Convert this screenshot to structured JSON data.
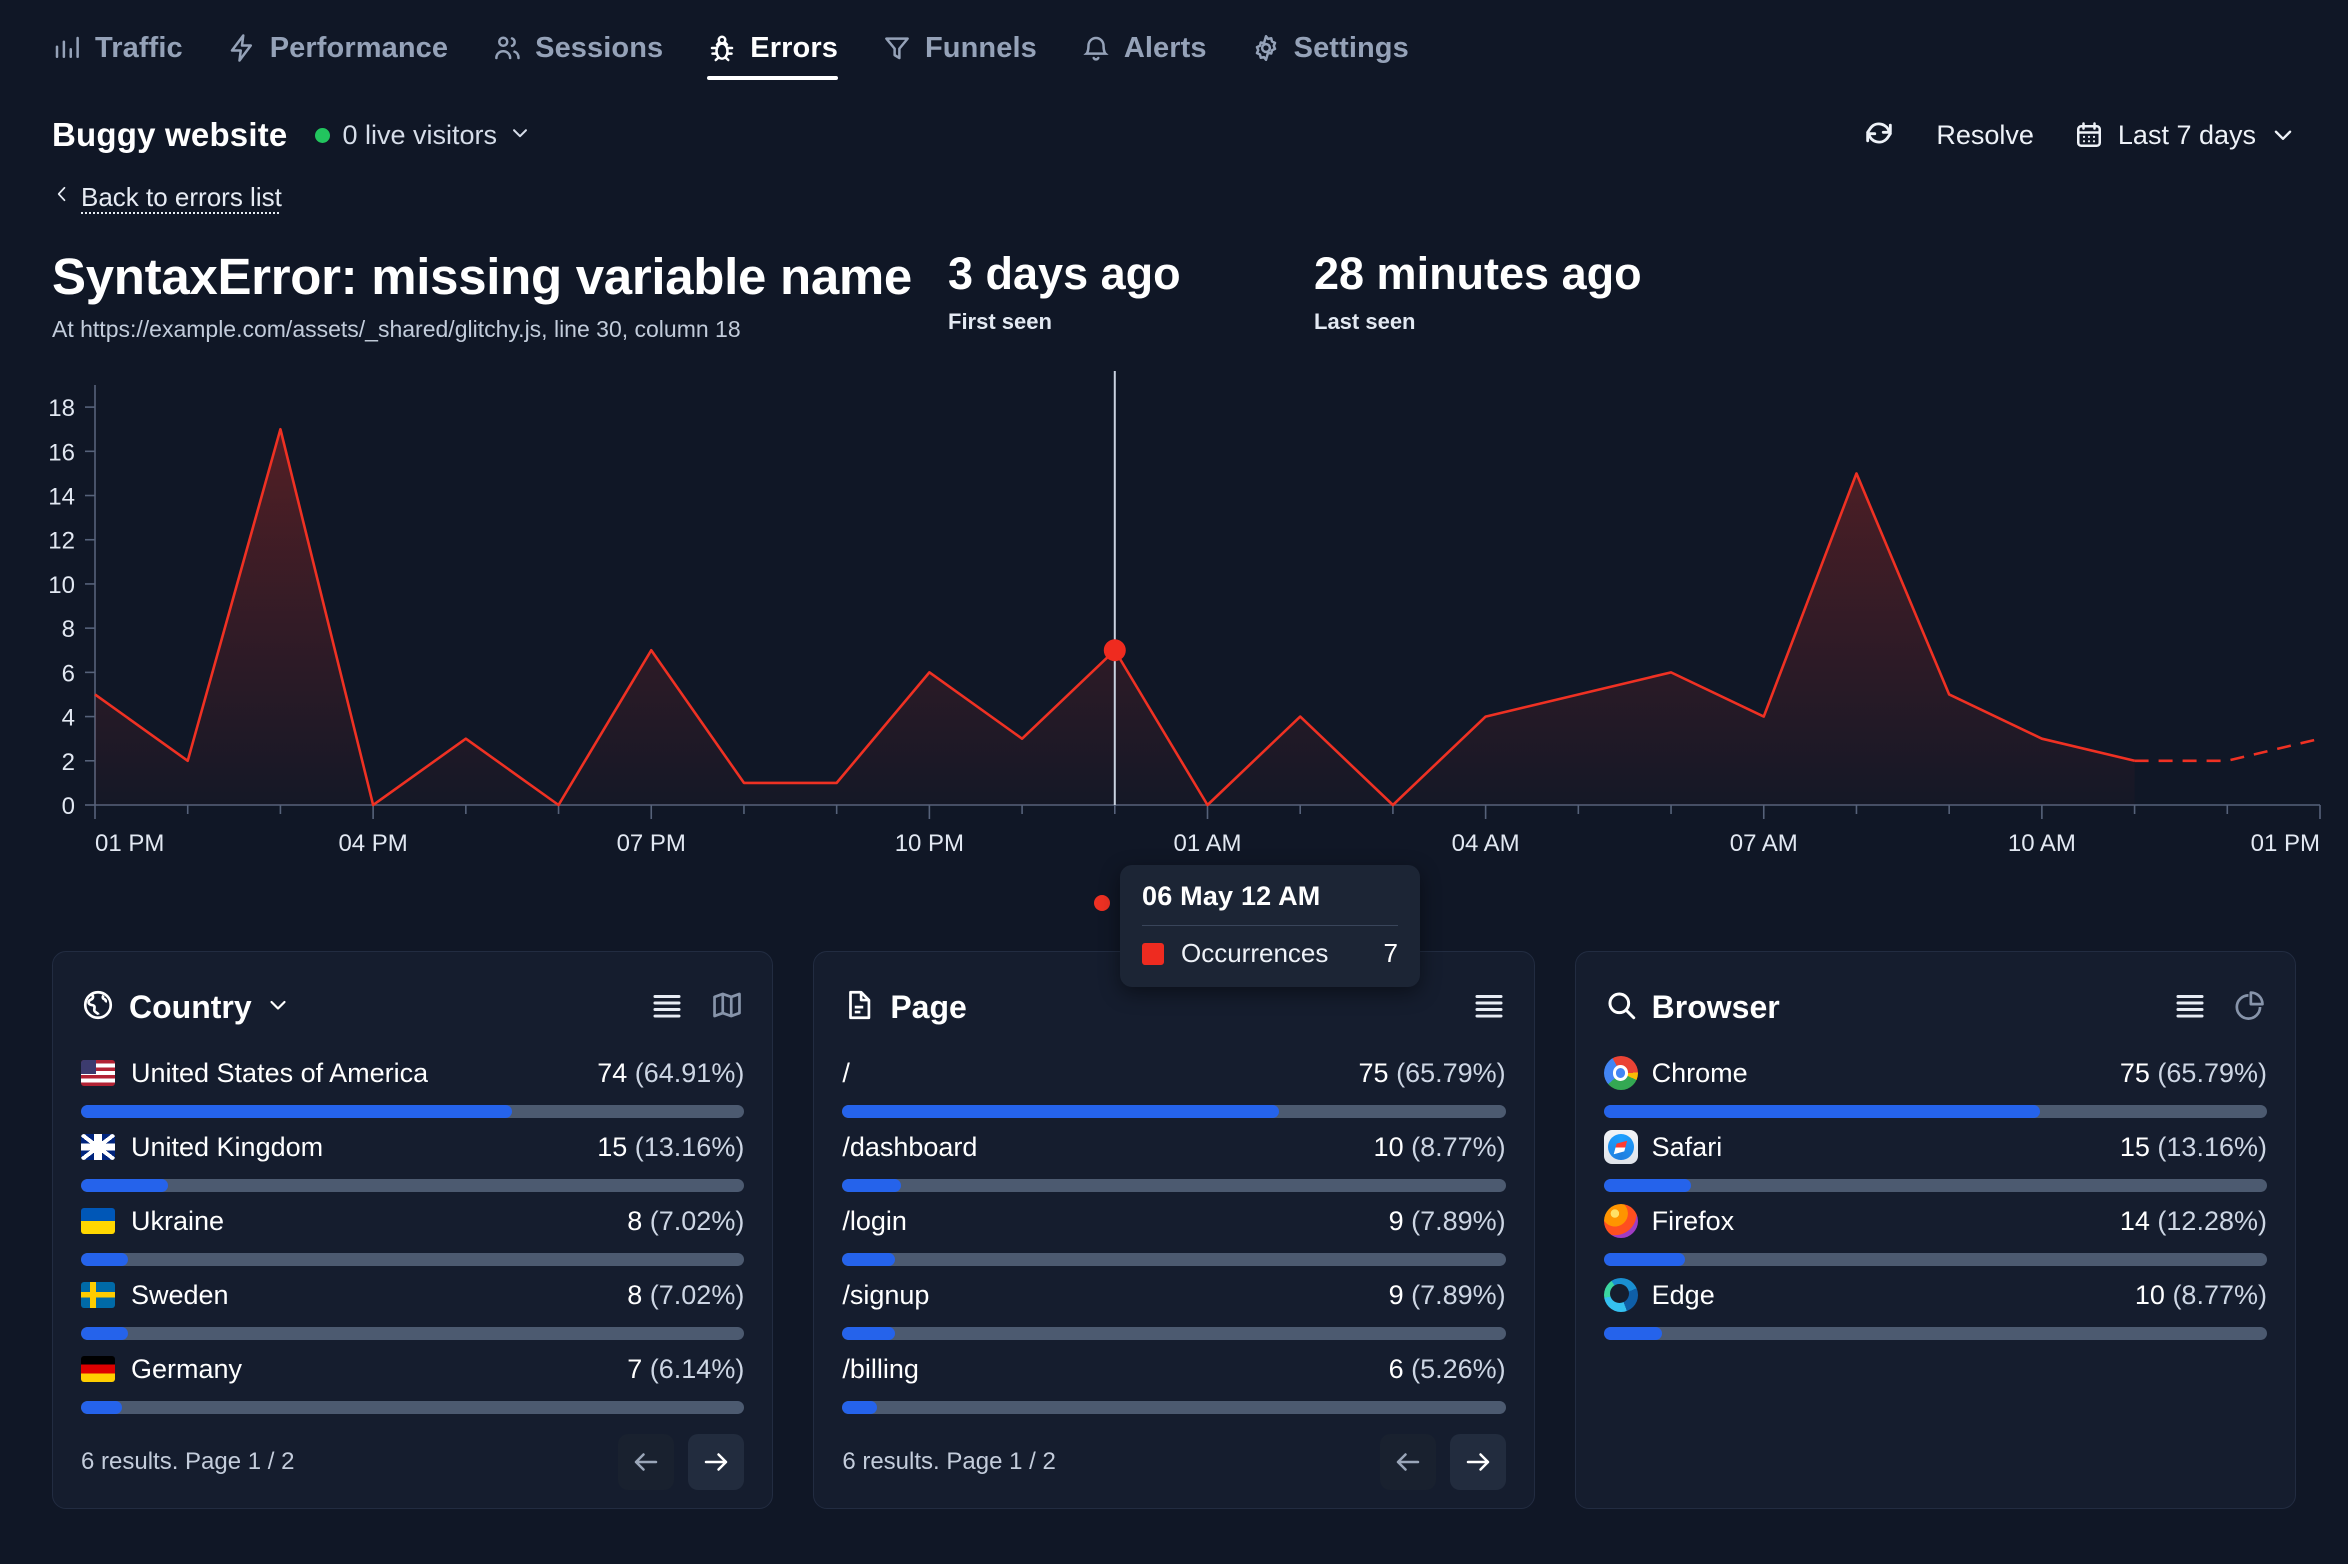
{
  "nav": {
    "items": [
      {
        "label": "Traffic",
        "icon": "bar-chart-icon",
        "active": false
      },
      {
        "label": "Performance",
        "icon": "lightning-icon",
        "active": false
      },
      {
        "label": "Sessions",
        "icon": "users-icon",
        "active": false
      },
      {
        "label": "Errors",
        "icon": "bug-icon",
        "active": true
      },
      {
        "label": "Funnels",
        "icon": "funnel-icon",
        "active": false
      },
      {
        "label": "Alerts",
        "icon": "bell-icon",
        "active": false
      },
      {
        "label": "Settings",
        "icon": "gear-icon",
        "active": false
      }
    ]
  },
  "header": {
    "site_name": "Buggy website",
    "live_visitors": "0 live visitors",
    "live_dot_color": "#22c55e",
    "refresh_icon": "refresh-icon",
    "resolve_label": "Resolve",
    "date_range_label": "Last 7 days",
    "calendar_icon": "calendar-icon",
    "chevron_icon": "chevron-down-icon"
  },
  "back_link": {
    "label": "Back to errors list",
    "icon": "chevron-left-icon"
  },
  "error": {
    "title": "SyntaxError: missing variable name",
    "location": "At https://example.com/assets/_shared/glitchy.js, line 30, column 18",
    "first_seen": {
      "value": "3 days ago",
      "caption": "First seen"
    },
    "last_seen": {
      "value": "28 minutes ago",
      "caption": "Last seen"
    }
  },
  "chart_data": {
    "type": "line",
    "title": "",
    "xlabel": "",
    "ylabel": "",
    "ylim": [
      0,
      19
    ],
    "yticks": [
      0,
      2,
      4,
      6,
      8,
      10,
      12,
      14,
      16,
      18
    ],
    "xticks": [
      "01 PM",
      "04 PM",
      "07 PM",
      "10 PM",
      "01 AM",
      "04 AM",
      "07 AM",
      "10 AM",
      "01 PM"
    ],
    "grid": false,
    "legend": [
      "Occurrences"
    ],
    "legend_position": "bottom",
    "series_color": "#ef3123",
    "series": [
      {
        "name": "Occurrences",
        "x": [
          "01 PM",
          "02 PM",
          "03 PM",
          "04 PM",
          "05 PM",
          "06 PM",
          "07 PM",
          "08 PM",
          "09 PM",
          "10 PM",
          "11 PM",
          "12 AM",
          "01 AM",
          "02 AM",
          "03 AM",
          "04 AM",
          "05 AM",
          "06 AM",
          "07 AM",
          "08 AM",
          "09 AM",
          "10 AM",
          "11 AM",
          "12 PM",
          "01 PM"
        ],
        "values": [
          5,
          2,
          17,
          0,
          3,
          0,
          7,
          1,
          1,
          6,
          3,
          7,
          0,
          4,
          0,
          4,
          5,
          6,
          4,
          15,
          5,
          3,
          2,
          2,
          3
        ]
      }
    ],
    "projected_from_index": 22,
    "highlight": {
      "x": "12 AM",
      "value": 7
    }
  },
  "tooltip": {
    "title": "06 May 12 AM",
    "series_name": "Occurrences",
    "series_value": "7",
    "swatch_color": "#ee2b20"
  },
  "legend": {
    "label": "Occurrences",
    "color": "#ef3123"
  },
  "cards": [
    {
      "title": "Country",
      "title_icon": "globe-icon",
      "has_chevron": true,
      "actions": [
        "list-view-icon",
        "map-view-icon"
      ],
      "rows": [
        {
          "label": "United States of America",
          "flag": "f-us",
          "count": "74",
          "percent": "(64.91%)",
          "bar_pct": 64.91
        },
        {
          "label": "United Kingdom",
          "flag": "f-uk",
          "count": "15",
          "percent": "(13.16%)",
          "bar_pct": 13.16
        },
        {
          "label": "Ukraine",
          "flag": "f-ua",
          "count": "8",
          "percent": "(7.02%)",
          "bar_pct": 7.02
        },
        {
          "label": "Sweden",
          "flag": "f-se",
          "count": "8",
          "percent": "(7.02%)",
          "bar_pct": 7.02
        },
        {
          "label": "Germany",
          "flag": "f-de",
          "count": "7",
          "percent": "(6.14%)",
          "bar_pct": 6.14
        }
      ],
      "footer": {
        "text": "6 results. Page 1 / 2",
        "prev_icon": "arrow-left-icon",
        "next_icon": "arrow-right-icon"
      }
    },
    {
      "title": "Page",
      "title_icon": "document-icon",
      "has_chevron": false,
      "actions": [
        "list-view-icon"
      ],
      "rows": [
        {
          "label": "/",
          "flag": "",
          "count": "75",
          "percent": "(65.79%)",
          "bar_pct": 65.79
        },
        {
          "label": "/dashboard",
          "flag": "",
          "count": "10",
          "percent": "(8.77%)",
          "bar_pct": 8.77
        },
        {
          "label": "/login",
          "flag": "",
          "count": "9",
          "percent": "(7.89%)",
          "bar_pct": 7.89
        },
        {
          "label": "/signup",
          "flag": "",
          "count": "9",
          "percent": "(7.89%)",
          "bar_pct": 7.89
        },
        {
          "label": "/billing",
          "flag": "",
          "count": "6",
          "percent": "(5.26%)",
          "bar_pct": 5.26
        }
      ],
      "footer": {
        "text": "6 results. Page 1 / 2",
        "prev_icon": "arrow-left-icon",
        "next_icon": "arrow-right-icon"
      }
    },
    {
      "title": "Browser",
      "title_icon": "search-icon",
      "has_chevron": false,
      "actions": [
        "list-view-icon",
        "pie-chart-icon"
      ],
      "rows": [
        {
          "label": "Chrome",
          "icon": "b-chrome",
          "count": "75",
          "percent": "(65.79%)",
          "bar_pct": 65.79
        },
        {
          "label": "Safari",
          "icon": "b-safari",
          "count": "15",
          "percent": "(13.16%)",
          "bar_pct": 13.16
        },
        {
          "label": "Firefox",
          "icon": "b-firefox",
          "count": "14",
          "percent": "(12.28%)",
          "bar_pct": 12.28
        },
        {
          "label": "Edge",
          "icon": "b-edge",
          "count": "10",
          "percent": "(8.77%)",
          "bar_pct": 8.77
        }
      ],
      "footer": null
    }
  ]
}
